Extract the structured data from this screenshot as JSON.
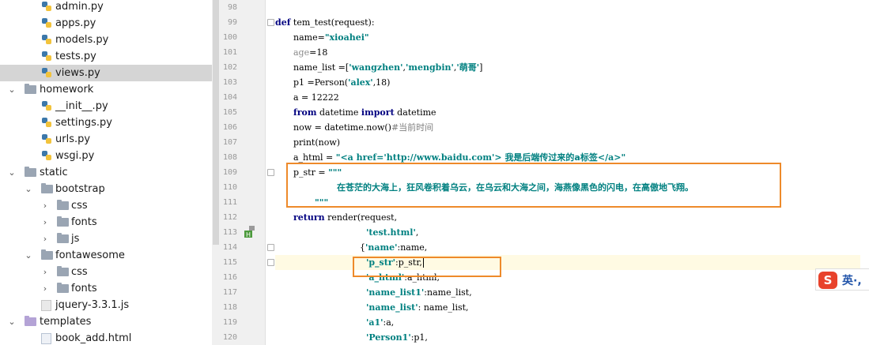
{
  "tree": {
    "rows": [
      {
        "label": "admin.py",
        "type": "py"
      },
      {
        "label": "apps.py",
        "type": "py"
      },
      {
        "label": "models.py",
        "type": "py"
      },
      {
        "label": "tests.py",
        "type": "py"
      },
      {
        "label": "views.py",
        "type": "py",
        "selected": true
      },
      {
        "label": "homework",
        "type": "folder",
        "expanded": true
      },
      {
        "label": "__init__.py",
        "type": "py"
      },
      {
        "label": "settings.py",
        "type": "py"
      },
      {
        "label": "urls.py",
        "type": "py"
      },
      {
        "label": "wsgi.py",
        "type": "py"
      },
      {
        "label": "static",
        "type": "folder",
        "expanded": true
      },
      {
        "label": "bootstrap",
        "type": "folder",
        "expanded": true
      },
      {
        "label": "css",
        "type": "folder",
        "expanded": false
      },
      {
        "label": "fonts",
        "type": "folder",
        "expanded": false
      },
      {
        "label": "js",
        "type": "folder",
        "expanded": false
      },
      {
        "label": "fontawesome",
        "type": "folder",
        "expanded": true
      },
      {
        "label": "css",
        "type": "folder",
        "expanded": false
      },
      {
        "label": "fonts",
        "type": "folder",
        "expanded": false
      },
      {
        "label": "jquery-3.3.1.js",
        "type": "js"
      },
      {
        "label": "templates",
        "type": "template-folder",
        "expanded": true
      },
      {
        "label": "book_add.html",
        "type": "html"
      }
    ]
  },
  "editor": {
    "line_numbers": [
      "98",
      "99",
      "100",
      "101",
      "102",
      "103",
      "104",
      "105",
      "106",
      "107",
      "108",
      "109",
      "110",
      "111",
      "112",
      "113",
      "114",
      "115",
      "116",
      "117",
      "118",
      "119",
      "120"
    ],
    "lines": [
      {
        "t": ""
      },
      {
        "t": "def tem_test(request):"
      },
      {
        "t": "name=\"xioahei\""
      },
      {
        "t": "age=18"
      },
      {
        "t": "name_list =['wangzhen','mengbin','萌哥']"
      },
      {
        "t": "p1 =Person('alex',18)"
      },
      {
        "t": "a = 12222"
      },
      {
        "t": "from datetime import  datetime"
      },
      {
        "t": "now = datetime.now()#当前时间"
      },
      {
        "t": "print(now)"
      },
      {
        "t": "a_html = \"<a href='http://www.baidu.com'> 我是后端传过来的a标签</a>\""
      },
      {
        "t": "p_str = \"\"\""
      },
      {
        "t": "在苍茫的大海上，狂风卷积着乌云，在乌云和大海之间，海燕像黑色的闪电，在高傲地飞翔。"
      },
      {
        "t": "\"\"\""
      },
      {
        "t": "return render(request,"
      },
      {
        "t": "'test.html',"
      },
      {
        "t": "{'name':name,"
      },
      {
        "t": "'p_str':p_str,"
      },
      {
        "t": "'a_html':a_html,"
      },
      {
        "t": "'name_list1':name_list,"
      },
      {
        "t": "'name_list': name_list,"
      },
      {
        "t": "'a1':a,"
      },
      {
        "t": "'Person1':p1,"
      }
    ]
  },
  "ime": {
    "label": "英",
    "suffix": "·,"
  },
  "colors": {
    "highlight_box": "#ee8a2a",
    "keyword": "#000080",
    "string": "#008080",
    "selected_row": "#d5d5d5"
  }
}
